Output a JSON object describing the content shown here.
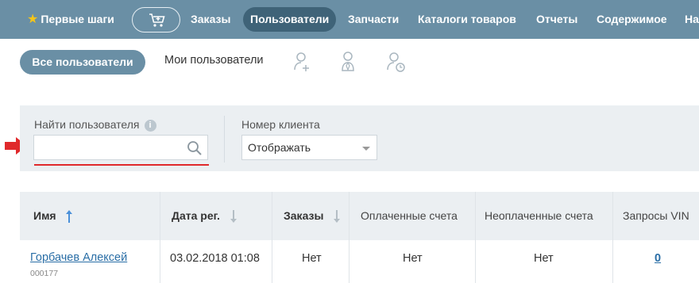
{
  "topnav": {
    "items": [
      {
        "label": "Первые шаги"
      },
      {
        "label": "Заказы"
      },
      {
        "label": "Пользователи",
        "active": true
      },
      {
        "label": "Запчасти"
      },
      {
        "label": "Каталоги товаров"
      },
      {
        "label": "Отчеты"
      },
      {
        "label": "Содержимое"
      },
      {
        "label": "На"
      }
    ],
    "cart_icon": "cart-plus-icon"
  },
  "subnav": {
    "all_users": "Все пользователи",
    "my_users": "Мои пользователи",
    "icons": [
      "add-user-icon",
      "user-manager-icon",
      "user-history-icon"
    ]
  },
  "filters": {
    "search_label": "Найти пользователя",
    "search_value": "",
    "search_placeholder": "",
    "client_number_label": "Номер клиента",
    "client_number_value": "Отображать"
  },
  "table": {
    "columns": [
      "Имя",
      "Дата рег.",
      "Заказы",
      "Оплаченные счета",
      "Неоплаченные счета",
      "Запросы VIN"
    ],
    "rows": [
      {
        "name": "Горбачев Алексей",
        "client_number": "000177",
        "reg_date": "03.02.2018 01:08",
        "orders": "Нет",
        "paid": "Нет",
        "unpaid": "Нет",
        "vin_requests": "0"
      }
    ]
  },
  "colors": {
    "nav_bg": "#6a8fa5",
    "nav_active": "#3f6378",
    "filter_bg": "#ebeff2",
    "link": "#2a6ea6",
    "sort_active": "#4a90d9",
    "highlight": "#e0292b"
  }
}
